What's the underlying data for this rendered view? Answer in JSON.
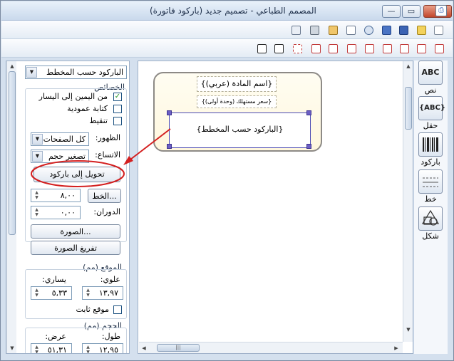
{
  "window": {
    "title": "المصمم الطباعي - تصميم جديد (باركود فاتورة)",
    "controls": {
      "minimize": "—",
      "maximize": "▭",
      "close": "✕"
    },
    "app_icon": "printer-icon"
  },
  "toolbar_top": {
    "icons": [
      "print-preview-icon",
      "print-icon",
      "paste-icon",
      "copy-icon",
      "cut-icon",
      "save-icon",
      "save-as-icon",
      "open-icon",
      "new-icon"
    ]
  },
  "toolbar_align": {
    "icons": [
      "group-icon",
      "ungroup-icon",
      "center-icon",
      "align-middle-icon",
      "align-center-icon",
      "same-width-icon",
      "align-left-icon",
      "align-right-icon",
      "align-top-icon",
      "align-bottom-icon"
    ]
  },
  "properties": {
    "element_combo": "الباركود حسب المخطط",
    "section_title": "الخصائص",
    "rtl_checkbox": {
      "label": "من اليمين إلى اليسار",
      "checked": true,
      "mark": "✓"
    },
    "vertical_checkbox": {
      "label": "كتابة عمودية",
      "checked": false,
      "mark": ""
    },
    "dotted_checkbox": {
      "label": "تنقيط",
      "checked": false,
      "mark": ""
    },
    "appearance_label": "الظهور:",
    "appearance_value": "كل الصفحات",
    "expand_label": "الاتساع:",
    "expand_value": "تصغير حجم",
    "convert_button": "تحويل إلى باركود",
    "font_button": "الخط...",
    "font_size": "٨,٠٠",
    "rotation_label": "الدوران:",
    "rotation_value": "٠,٠٠",
    "image_button": "الصورة...",
    "clear_image_button": "تفريغ الصورة"
  },
  "position": {
    "title": "الموقع (مم)",
    "top_label": "علوي:",
    "top_value": "١٣,٩٧",
    "left_label": "يساري:",
    "left_value": "٥,٣٣",
    "fixed_label": "موقع ثابت"
  },
  "size": {
    "title": "الحجم (مم)",
    "height_label": "طول:",
    "height_value": "١٢,٩٥",
    "width_label": "عرض:",
    "width_value": "٥١,٣١"
  },
  "canvas": {
    "field1": "{اسم المادة (عربي)}",
    "field2": "{سعر مستهلك (وحدة أولى)}",
    "barcode": "{الباركود حسب المخطط}"
  },
  "palette": {
    "text": {
      "icon": "ABC",
      "label": "نص"
    },
    "field": {
      "icon": "{ABC}",
      "label": "حقل"
    },
    "barcode": {
      "label": "باركود"
    },
    "line": {
      "label": "خط"
    },
    "shape": {
      "label": "شكل"
    }
  },
  "colors": {
    "annotation": "#d42020",
    "selection": "#4a4ab4",
    "handle": "#6b5ec4"
  }
}
